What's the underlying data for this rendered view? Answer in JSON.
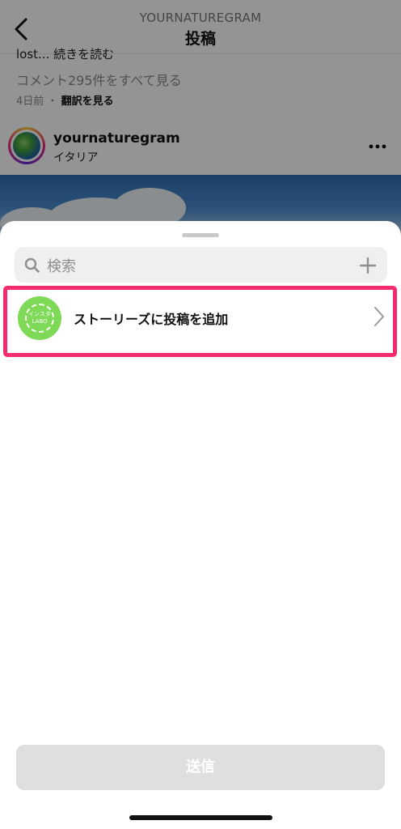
{
  "header": {
    "subtitle": "YOURNATUREGRAM",
    "title": "投稿"
  },
  "post": {
    "caption_cut": "lost... 続きを読む",
    "comments_link": "コメント295件をすべて見る",
    "time": "4日前",
    "dot": "・",
    "translate": "翻訳を見る",
    "username": "yournaturegram",
    "location": "イタリア"
  },
  "sheet": {
    "search_placeholder": "検索",
    "story_row": {
      "label": "ストーリーズに投稿を追加",
      "avatar_text_line1": "インスタ",
      "avatar_text_line2": "LABO"
    },
    "send_label": "送信"
  },
  "colors": {
    "highlight_border": "#f32c6e",
    "avatar_green": "#7ed957",
    "send_disabled": "#dedfe1"
  }
}
